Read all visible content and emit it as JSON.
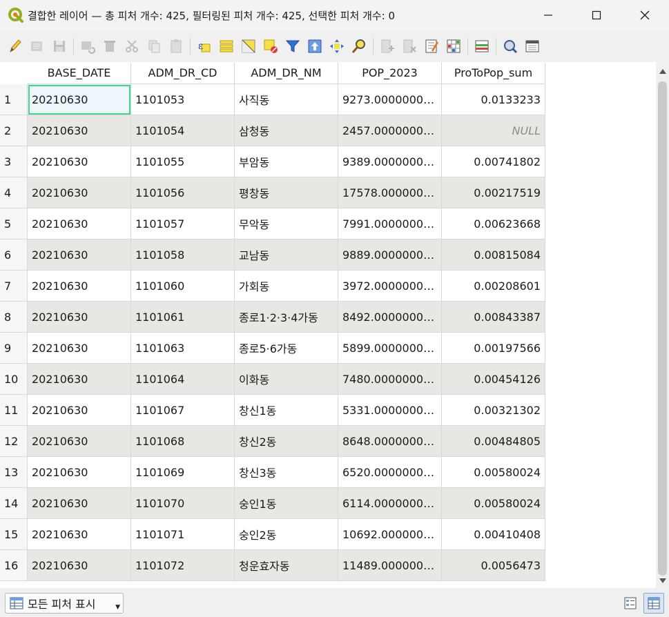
{
  "window": {
    "title": "결합한 레이어 — 총 피처 개수: 425, 필터링된 피처 개수: 425, 선택한 피처 개수: 0"
  },
  "toolbar": {
    "icons": [
      "pencil-icon",
      "multi-edit-icon",
      "save-edits-icon",
      "reload-icon",
      "delete-feature-icon",
      "cut-icon",
      "copy-icon",
      "paste-icon",
      "select-expression-icon",
      "select-all-icon",
      "invert-selection-icon",
      "deselect-icon",
      "filter-icon",
      "move-top-icon",
      "pan-to-icon",
      "zoom-to-icon",
      "new-field-icon",
      "delete-field-icon",
      "field-calculator-icon",
      "conditional-format-icon",
      "dock-icon",
      "actions-icon",
      "organize-columns-icon"
    ]
  },
  "table": {
    "columns": [
      "BASE_DATE",
      "ADM_DR_CD",
      "ADM_DR_NM",
      "POP_2023",
      "ProToPop_sum"
    ],
    "rows": [
      {
        "n": "1",
        "base_date": "20210630",
        "cd": "1101053",
        "nm": "사직동",
        "pop": "9273.0000000000000",
        "sum": "0.0133233"
      },
      {
        "n": "2",
        "base_date": "20210630",
        "cd": "1101054",
        "nm": "삼청동",
        "pop": "2457.0000000000000",
        "sum": "NULL"
      },
      {
        "n": "3",
        "base_date": "20210630",
        "cd": "1101055",
        "nm": "부암동",
        "pop": "9389.0000000000000",
        "sum": "0.00741802"
      },
      {
        "n": "4",
        "base_date": "20210630",
        "cd": "1101056",
        "nm": "평창동",
        "pop": "17578.000000000000",
        "sum": "0.00217519"
      },
      {
        "n": "5",
        "base_date": "20210630",
        "cd": "1101057",
        "nm": "무악동",
        "pop": "7991.0000000000000",
        "sum": "0.00623668"
      },
      {
        "n": "6",
        "base_date": "20210630",
        "cd": "1101058",
        "nm": "교남동",
        "pop": "9889.0000000000000",
        "sum": "0.00815084"
      },
      {
        "n": "7",
        "base_date": "20210630",
        "cd": "1101060",
        "nm": "가회동",
        "pop": "3972.0000000000000",
        "sum": "0.00208601"
      },
      {
        "n": "8",
        "base_date": "20210630",
        "cd": "1101061",
        "nm": "종로1·2·3·4가동",
        "pop": "8492.0000000000000",
        "sum": "0.00843387"
      },
      {
        "n": "9",
        "base_date": "20210630",
        "cd": "1101063",
        "nm": "종로5·6가동",
        "pop": "5899.0000000000000",
        "sum": "0.00197566"
      },
      {
        "n": "10",
        "base_date": "20210630",
        "cd": "1101064",
        "nm": "이화동",
        "pop": "7480.0000000000000",
        "sum": "0.00454126"
      },
      {
        "n": "11",
        "base_date": "20210630",
        "cd": "1101067",
        "nm": "창신1동",
        "pop": "5331.0000000000000",
        "sum": "0.00321302"
      },
      {
        "n": "12",
        "base_date": "20210630",
        "cd": "1101068",
        "nm": "창신2동",
        "pop": "8648.0000000000000",
        "sum": "0.00484805"
      },
      {
        "n": "13",
        "base_date": "20210630",
        "cd": "1101069",
        "nm": "창신3동",
        "pop": "6520.0000000000000",
        "sum": "0.00580024"
      },
      {
        "n": "14",
        "base_date": "20210630",
        "cd": "1101070",
        "nm": "숭인1동",
        "pop": "6114.0000000000000",
        "sum": "0.00580024"
      },
      {
        "n": "15",
        "base_date": "20210630",
        "cd": "1101071",
        "nm": "숭인2동",
        "pop": "10692.000000000000",
        "sum": "0.00410408"
      },
      {
        "n": "16",
        "base_date": "20210630",
        "cd": "1101072",
        "nm": "청운효자동",
        "pop": "11489.000000000000",
        "sum": "0.0056473"
      }
    ]
  },
  "footer": {
    "show_all_label": "모든 피처 표시"
  },
  "colors": {
    "current_cell_outline": "#3cd98a",
    "alt_row_bg": "#e9e7e3",
    "null_text": "#8c8c8c"
  }
}
